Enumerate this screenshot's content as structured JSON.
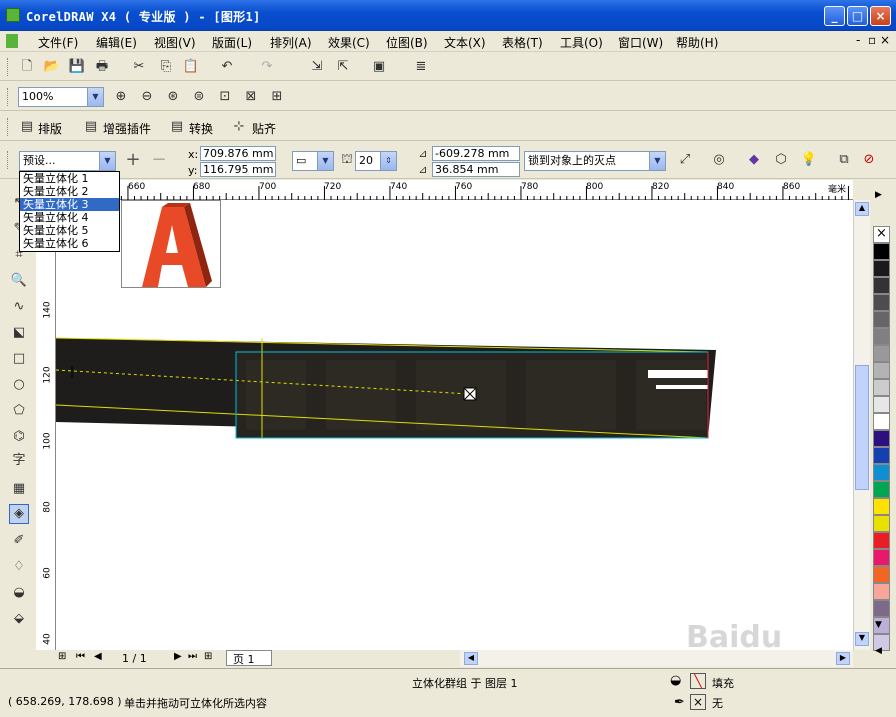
{
  "window": {
    "title": "CorelDRAW X4 ( 专业版 ) - [图形1]"
  },
  "menu": [
    "文件(F)",
    "编辑(E)",
    "视图(V)",
    "版面(L)",
    "排列(A)",
    "效果(C)",
    "位图(B)",
    "文本(X)",
    "表格(T)",
    "工具(O)",
    "窗口(W)",
    "帮助(H)"
  ],
  "zoom": "100%",
  "plugins": {
    "paiban": "排版",
    "zengqiang": "增强插件",
    "zhuanhuan": "转换",
    "tieqi": "贴齐"
  },
  "property_bar": {
    "preset_value": "预设...",
    "x_label": "x:",
    "x_value": "709.876 mm",
    "y_label": "y:",
    "y_value": "116.795 mm",
    "depth_value": "20",
    "vp_x": "-609.278 mm",
    "vp_y": "36.854 mm",
    "vanishing": "锁到对象上的灭点"
  },
  "preset_options": [
    "矢量立体化 1",
    "矢量立体化 2",
    "矢量立体化 3",
    "矢量立体化 4",
    "矢量立体化 5",
    "矢量立体化 6"
  ],
  "preset_selected_index": 2,
  "ruler": {
    "h_ticks": [
      "660",
      "680",
      "700",
      "720",
      "740",
      "760",
      "780",
      "800",
      "820",
      "840",
      "860"
    ],
    "h_unit": "毫米",
    "v_ticks": [
      "140",
      "120",
      "100",
      "80",
      "60",
      "40"
    ]
  },
  "page_nav": {
    "page_count": "1 / 1",
    "page_tab": "页 1"
  },
  "status": {
    "coords": "( 658.269, 178.698 )",
    "hint": "单击并拖动可立体化所选内容",
    "object": "立体化群组 于 图层 1",
    "fill_label": "填充",
    "outline_label": "无"
  },
  "colors": {
    "accent": "#316ac5",
    "extrude": "#1e1d1b",
    "preview_letter": "#e84a27"
  },
  "palette": [
    "#000000",
    "#1a1a1a",
    "#333333",
    "#4d4d4d",
    "#666666",
    "#808080",
    "#999999",
    "#b3b3b3",
    "#cccccc",
    "#e6e6e6",
    "#ffffff",
    "#2e0f7f",
    "#1540b0",
    "#0d8fd1",
    "#00a651",
    "#ffe100",
    "#e8e100",
    "#ec1c24",
    "#e8186d",
    "#f26522",
    "#f9a59a",
    "#7d6a8b",
    "#bcb0d9",
    "#d0c9e6"
  ]
}
